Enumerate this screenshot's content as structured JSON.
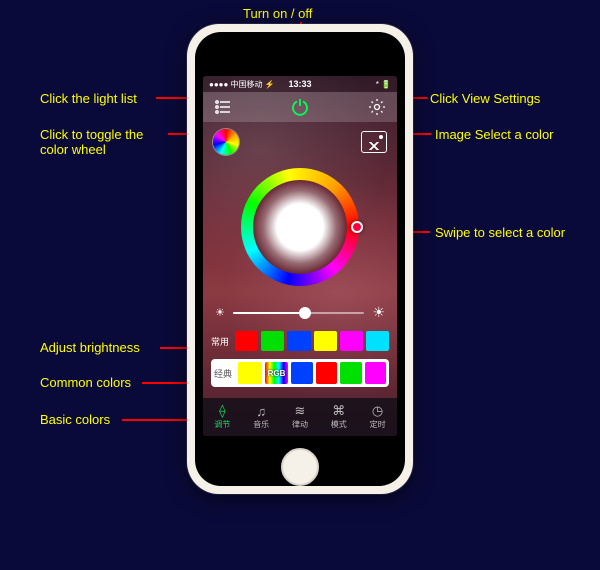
{
  "callouts": {
    "turn_on_off": "Turn on / off",
    "light_list": "Click the light list",
    "view_settings": "Click View Settings",
    "toggle_wheel_l1": "Click to toggle the",
    "toggle_wheel_l2": "color wheel",
    "image_select": "Image Select a color",
    "swipe_color": "Swipe to select a color",
    "adjust_brightness": "Adjust brightness",
    "common_colors": "Common colors",
    "basic_colors": "Basic colors"
  },
  "status": {
    "carrier": "●●●● 中国移动 ⚡",
    "time": "13:33",
    "right": "* 🔋"
  },
  "swatches": {
    "common_label": "常用",
    "common": [
      "#ff0000",
      "#00e000",
      "#0040ff",
      "#ffff00",
      "#ff00ff",
      "#00e0ff"
    ],
    "basic_label": "经典",
    "basic_first": "#ffff00",
    "basic_rgb_label": "RGB",
    "basic": [
      "#0040ff",
      "#ff0000",
      "#00e000",
      "#ff00ff"
    ]
  },
  "tabs": [
    {
      "icon": "⟠",
      "label": "调节",
      "active": true
    },
    {
      "icon": "♫",
      "label": "音乐",
      "active": false
    },
    {
      "icon": "≋",
      "label": "律动",
      "active": false
    },
    {
      "icon": "⌘",
      "label": "模式",
      "active": false
    },
    {
      "icon": "◷",
      "label": "定时",
      "active": false
    }
  ]
}
